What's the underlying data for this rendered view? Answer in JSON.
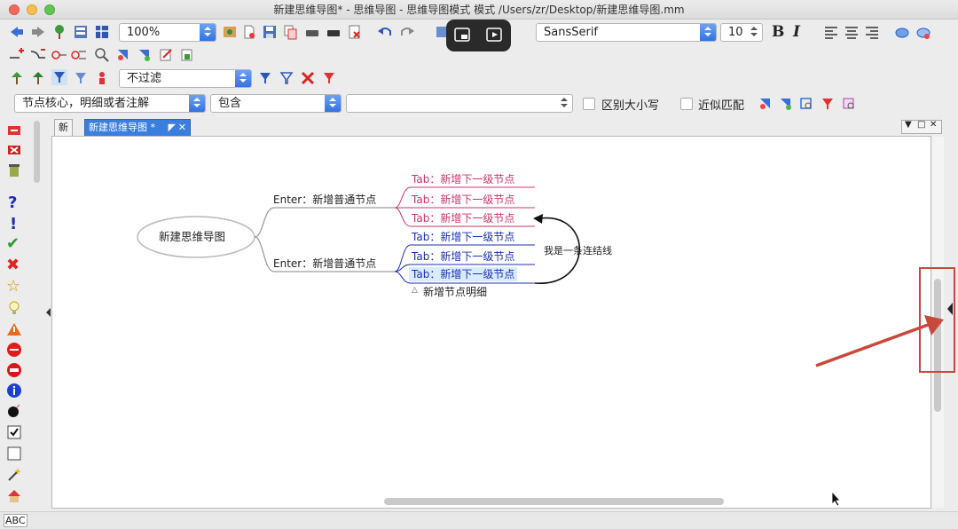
{
  "window": {
    "title": "新建思维导图* - 思维导图 - 思维导图模式 模式 /Users/zr/Desktop/新建思维导图.mm"
  },
  "toolbar": {
    "zoom_value": "100%",
    "font_family": "SansSerif",
    "font_size": "10",
    "bold_label": "B",
    "italic_label": "I",
    "filter_value": "不过滤"
  },
  "search": {
    "field_value": "节点核心，明细或者注解",
    "operator_value": "包含",
    "text_value": "",
    "case_label": "区别大小写",
    "approx_label": "近似匹配"
  },
  "tabs": [
    {
      "label": "新建"
    },
    {
      "label": "新建思维导图 *"
    }
  ],
  "mindmap": {
    "root": "新建思维导图",
    "branch1": {
      "label": "Enter：新增普通节点",
      "children": [
        "Tab：新增下一级节点",
        "Tab：新增下一级节点",
        "Tab：新增下一级节点"
      ]
    },
    "branch2": {
      "label": "Enter：新增普通节点",
      "children": [
        "Tab：新增下一级节点",
        "Tab：新增下一级节点",
        "Tab：新增下一级节点"
      ]
    },
    "connector_label": "我是一条连结线",
    "detail": "新增节点明细"
  },
  "status": {
    "spell_label": "ABC"
  },
  "colors": {
    "accent_pink": "#c8356a",
    "accent_blue": "#1c2fb0",
    "annotation_red": "#c9483c",
    "selected_bg": "#d9ecff"
  }
}
